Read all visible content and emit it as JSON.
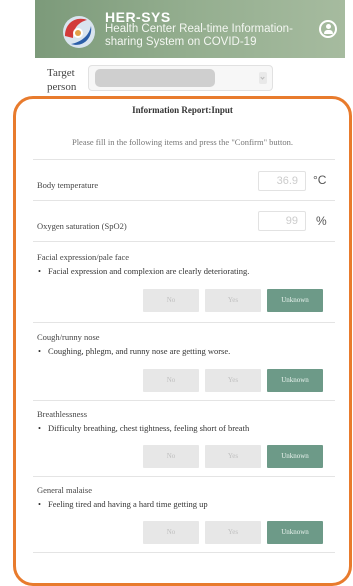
{
  "header": {
    "app_name": "HER-SYS",
    "app_subtitle": "Health Center Real-time Information-sharing System on COVID-19"
  },
  "target": {
    "label": "Target person",
    "value": ""
  },
  "report": {
    "title": "Information Report:Input",
    "instruction": "Please fill in the following items and press the \"Confirm\" button.",
    "measurements": [
      {
        "label": "Body temperature",
        "value": "36.9",
        "unit": "°C"
      },
      {
        "label": "Oxygen saturation (SpO2)",
        "value": "99",
        "unit": "%"
      }
    ],
    "questions": [
      {
        "title": "Facial expression/pale face",
        "bullet": "Facial expression and complexion are clearly deteriorating.",
        "selected": "Unknown"
      },
      {
        "title": "Cough/runny nose",
        "bullet": "Coughing, phlegm, and runny nose are getting worse.",
        "selected": "Unknown"
      },
      {
        "title": "Breathlessness",
        "bullet": "Difficulty breathing, chest tightness, feeling short of breath",
        "selected": "Unknown"
      },
      {
        "title": "General malaise",
        "bullet": "Feeling tired and having a hard time getting up",
        "selected": "Unknown"
      }
    ],
    "choices": {
      "no": "No",
      "yes": "Yes",
      "unknown": "Unknown"
    }
  },
  "colors": {
    "accent_orange": "#e87b2d",
    "selected_green": "#6d9a88",
    "header_green": "#8aa684"
  }
}
